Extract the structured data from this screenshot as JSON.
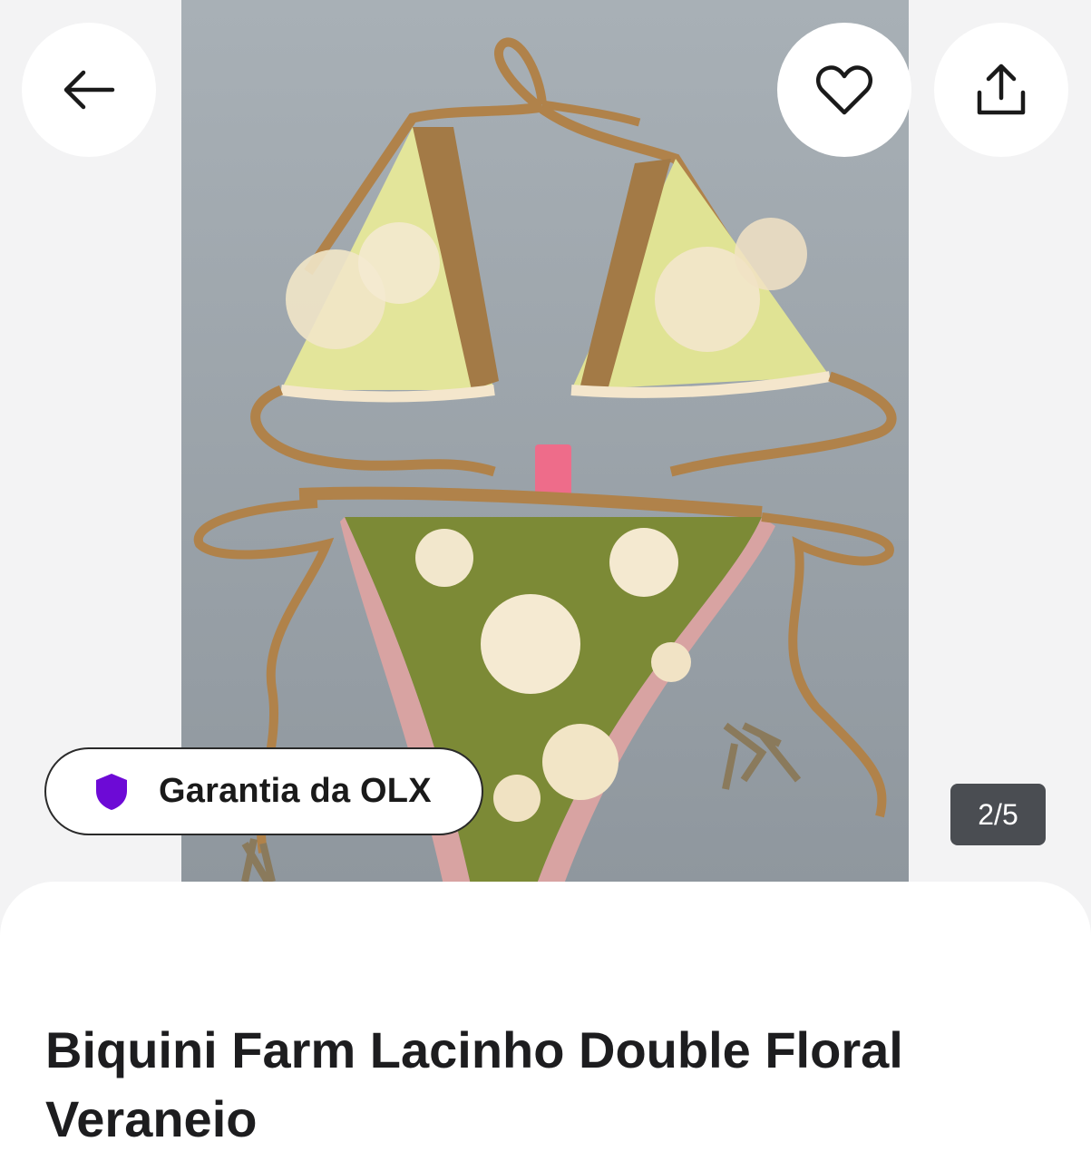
{
  "gallery": {
    "photo_alt": "Biquini Farm Lacinho Double Floral Veraneio",
    "counter": "2/5"
  },
  "header": {
    "back_icon": "arrow-left-icon",
    "favorite_icon": "heart-icon",
    "share_icon": "share-icon"
  },
  "badge": {
    "label": "Garantia da OLX",
    "icon": "shield-icon",
    "icon_color": "#6d0ad6"
  },
  "listing": {
    "title": "Biquini Farm Lacinho Double Floral Veraneio"
  }
}
